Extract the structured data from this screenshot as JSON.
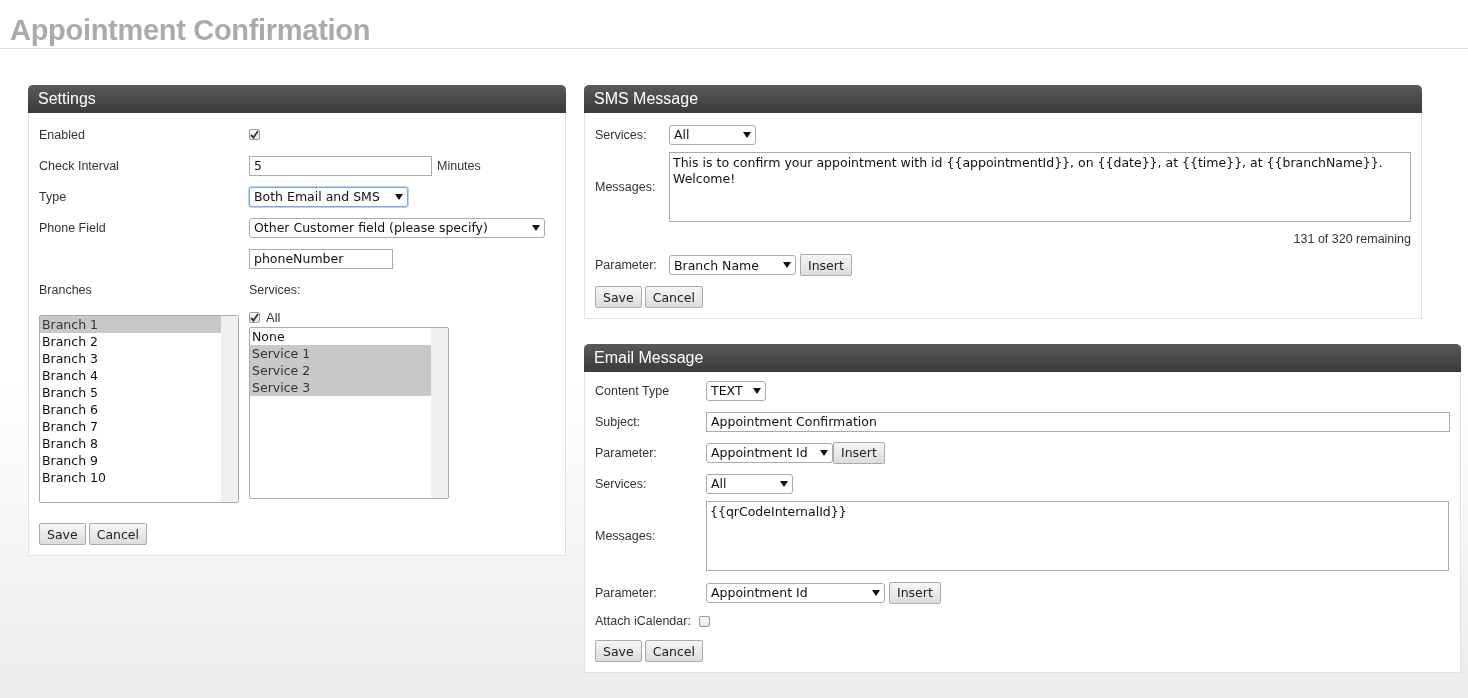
{
  "page_title": "Appointment Confirmation",
  "settings": {
    "title": "Settings",
    "enabled": {
      "label": "Enabled",
      "checked": true
    },
    "check_interval": {
      "label": "Check Interval",
      "value": "5",
      "unit": "Minutes"
    },
    "type": {
      "label": "Type",
      "value": "Both Email and SMS",
      "focused": true
    },
    "phone_field": {
      "label": "Phone Field",
      "value": "Other Customer field (please specify)",
      "custom_value": "phoneNumber"
    },
    "branches": {
      "label": "Branches",
      "items": [
        {
          "label": "Branch 1",
          "selected": true
        },
        {
          "label": "Branch 2",
          "selected": false
        },
        {
          "label": "Branch 3",
          "selected": false
        },
        {
          "label": "Branch 4",
          "selected": false
        },
        {
          "label": "Branch 5",
          "selected": false
        },
        {
          "label": "Branch 6",
          "selected": false
        },
        {
          "label": "Branch 7",
          "selected": false
        },
        {
          "label": "Branch 8",
          "selected": false
        },
        {
          "label": "Branch 9",
          "selected": false
        },
        {
          "label": "Branch 10",
          "selected": false
        }
      ]
    },
    "services": {
      "label": "Services:",
      "all": {
        "label": "All",
        "checked": true
      },
      "items": [
        {
          "label": "None",
          "selected": false
        },
        {
          "label": "Service 1",
          "selected": true
        },
        {
          "label": "Service 2",
          "selected": true
        },
        {
          "label": "Service 3",
          "selected": true
        }
      ]
    },
    "buttons": [
      "Save",
      "Cancel"
    ]
  },
  "sms": {
    "title": "SMS Message",
    "services": {
      "label": "Services:",
      "value": "All"
    },
    "messages": {
      "label": "Messages:",
      "value": "This is to confirm your appointment with id {{appointmentId}}, on {{date}}, at {{time}}, at {{branchName}}.\nWelcome!"
    },
    "remaining": "131 of 320 remaining",
    "parameter": {
      "label": "Parameter:",
      "value": "Branch Name",
      "button": "Insert"
    },
    "buttons": [
      "Save",
      "Cancel"
    ]
  },
  "email": {
    "title": "Email Message",
    "content_type": {
      "label": "Content Type",
      "value": "TEXT"
    },
    "subject": {
      "label": "Subject:",
      "value": "Appointment Confirmation"
    },
    "parameter": {
      "label": "Parameter:",
      "value": "Appointment Id",
      "button": "Insert"
    },
    "services": {
      "label": "Services:",
      "value": "All"
    },
    "messages": {
      "label": "Messages:",
      "value": "{{qrCodeInternalId}}"
    },
    "parameter_2": {
      "label": "Parameter:",
      "value": "Appointment Id",
      "button": "Insert"
    },
    "attach_icalendar": {
      "label": "Attach iCalendar:",
      "checked": false
    },
    "buttons": [
      "Save",
      "Cancel"
    ]
  }
}
